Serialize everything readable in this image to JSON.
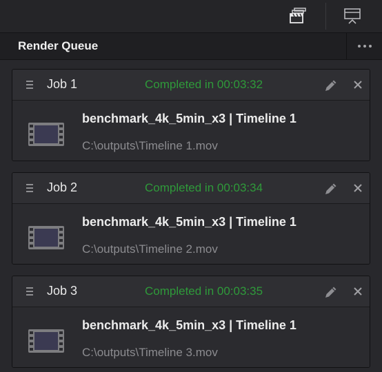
{
  "panel": {
    "title": "Render Queue"
  },
  "jobs": [
    {
      "name": "Job 1",
      "status": "Completed in 00:03:32",
      "title": "benchmark_4k_5min_x3 | Timeline 1",
      "path": "C:\\outputs\\Timeline 1.mov"
    },
    {
      "name": "Job 2",
      "status": "Completed in 00:03:34",
      "title": "benchmark_4k_5min_x3 | Timeline 1",
      "path": "C:\\outputs\\Timeline 2.mov"
    },
    {
      "name": "Job 3",
      "status": "Completed in 00:03:35",
      "title": "benchmark_4k_5min_x3 | Timeline 1",
      "path": "C:\\outputs\\Timeline 3.mov"
    }
  ],
  "colors": {
    "status_complete": "#2f9a3a",
    "background": "#1d1d20"
  },
  "icons": [
    "clapperboard-stack-icon",
    "monitor-output-icon",
    "more-options-icon",
    "drag-handle-icon",
    "edit-pencil-icon",
    "close-icon",
    "film-strip-icon"
  ]
}
